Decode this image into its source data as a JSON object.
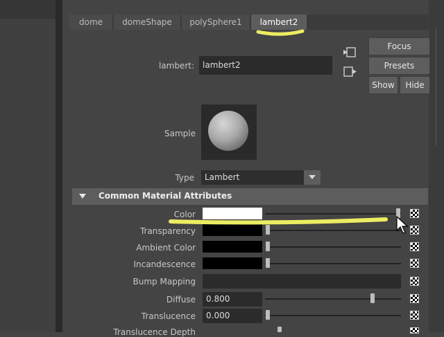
{
  "tabs": [
    {
      "label": "dome",
      "active": false
    },
    {
      "label": "domeShape",
      "active": false
    },
    {
      "label": "polySphere1",
      "active": false
    },
    {
      "label": "lambert2",
      "active": true
    }
  ],
  "header": {
    "name_label": "lambert:",
    "name_value": "lambert2",
    "focus_label": "Focus",
    "presets_label": "Presets",
    "show_label": "Show",
    "hide_label": "Hide"
  },
  "sample": {
    "label": "Sample"
  },
  "type": {
    "label": "Type",
    "value": "Lambert"
  },
  "section": {
    "title": "Common Material Attributes"
  },
  "attributes": {
    "color": {
      "label": "Color",
      "swatch": "#ffffff",
      "slider": 1.0
    },
    "transparency": {
      "label": "Transparency",
      "swatch": "#000000",
      "slider": 0.0
    },
    "ambient": {
      "label": "Ambient Color",
      "swatch": "#000000",
      "slider": 0.0
    },
    "incandescence": {
      "label": "Incandescence",
      "swatch": "#000000",
      "slider": 0.0
    },
    "bump": {
      "label": "Bump Mapping"
    },
    "diffuse": {
      "label": "Diffuse",
      "value": "0.800",
      "slider": 0.8
    },
    "translucence": {
      "label": "Translucence",
      "value": "0.000",
      "slider": 0.0
    },
    "translucence_depth": {
      "label": "Translucence Depth"
    }
  },
  "annotation_color": "#ffff66"
}
